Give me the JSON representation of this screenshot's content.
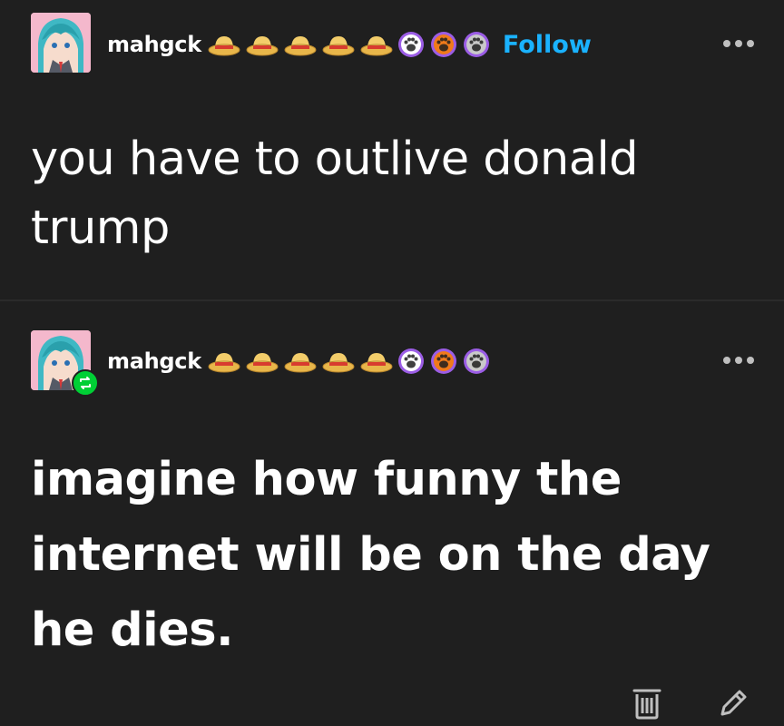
{
  "post1": {
    "username": "mahgck",
    "follow_label": "Follow",
    "text": "you have to outlive donald trump"
  },
  "post2": {
    "username": "mahgck",
    "text": "imagine how funny the internet will be on the day he dies."
  },
  "badges": [
    "straw-hat-badge",
    "straw-hat-badge",
    "straw-hat-badge",
    "straw-hat-badge",
    "straw-hat-badge",
    "pink-paw-badge",
    "orange-paw-badge",
    "gray-paw-badge"
  ],
  "colors": {
    "background": "#1f1f1f",
    "follow": "#1ab2ff",
    "reblog": "#00cf35",
    "badge_ring": "#9b5de5"
  },
  "icons": [
    "more-options-icon",
    "reblog-icon",
    "delete-icon",
    "edit-icon"
  ]
}
